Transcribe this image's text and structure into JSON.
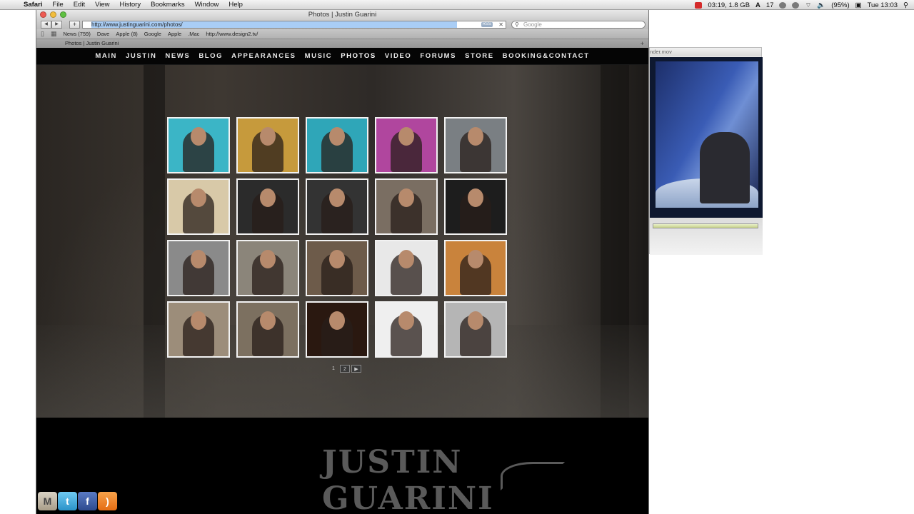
{
  "menubar": {
    "app": "Safari",
    "items": [
      "File",
      "Edit",
      "View",
      "History",
      "Bookmarks",
      "Window",
      "Help"
    ],
    "status": {
      "memory": "03:19, 1.8 GB",
      "count": "17",
      "battery": "(95%)",
      "clock": "Tue 13:03"
    }
  },
  "window": {
    "title": "Photos | Justin Guarini",
    "url": "http://www.justinguarini.com/photos/",
    "search_placeholder": "Google",
    "rss_label": "RSS",
    "bookmarks": [
      "News (759)",
      "Dave",
      "Apple (8)",
      "Google",
      "Apple",
      ".Mac",
      "http://www.design2.tv/"
    ],
    "tab_label": "Photos | Justin Guarini"
  },
  "site": {
    "nav": [
      "MAIN",
      "JUSTIN",
      "NEWS",
      "BLOG",
      "APPEARANCES",
      "MUSIC",
      "PHOTOS",
      "VIDEO",
      "FORUMS",
      "STORE",
      "BOOKING&CONTACT"
    ],
    "active_nav": "PHOTOS",
    "pager": {
      "current": "1",
      "next_page": "2",
      "next_arrow": "▶"
    },
    "logo_text": "JUSTIN GUARINI",
    "social": [
      {
        "name": "myspace",
        "glyph": "M"
      },
      {
        "name": "twitter",
        "glyph": "t"
      },
      {
        "name": "facebook",
        "glyph": "f"
      },
      {
        "name": "rss",
        "glyph": ")"
      }
    ],
    "thumb_colors": [
      "#3bb5c6",
      "#c69a3c",
      "#2fa6b8",
      "#b0469e",
      "#7a7f83",
      "#d8c9a8",
      "#2b2b2b",
      "#333333",
      "#7a6e62",
      "#1d1d1d",
      "#8a8a8a",
      "#8b857a",
      "#6d5b4a",
      "#e8e8e8",
      "#c9833c",
      "#9c8d7a",
      "#7c7060",
      "#2a1810",
      "#efefef",
      "#b5b5b5"
    ]
  },
  "movie": {
    "title": "nder.mov"
  }
}
